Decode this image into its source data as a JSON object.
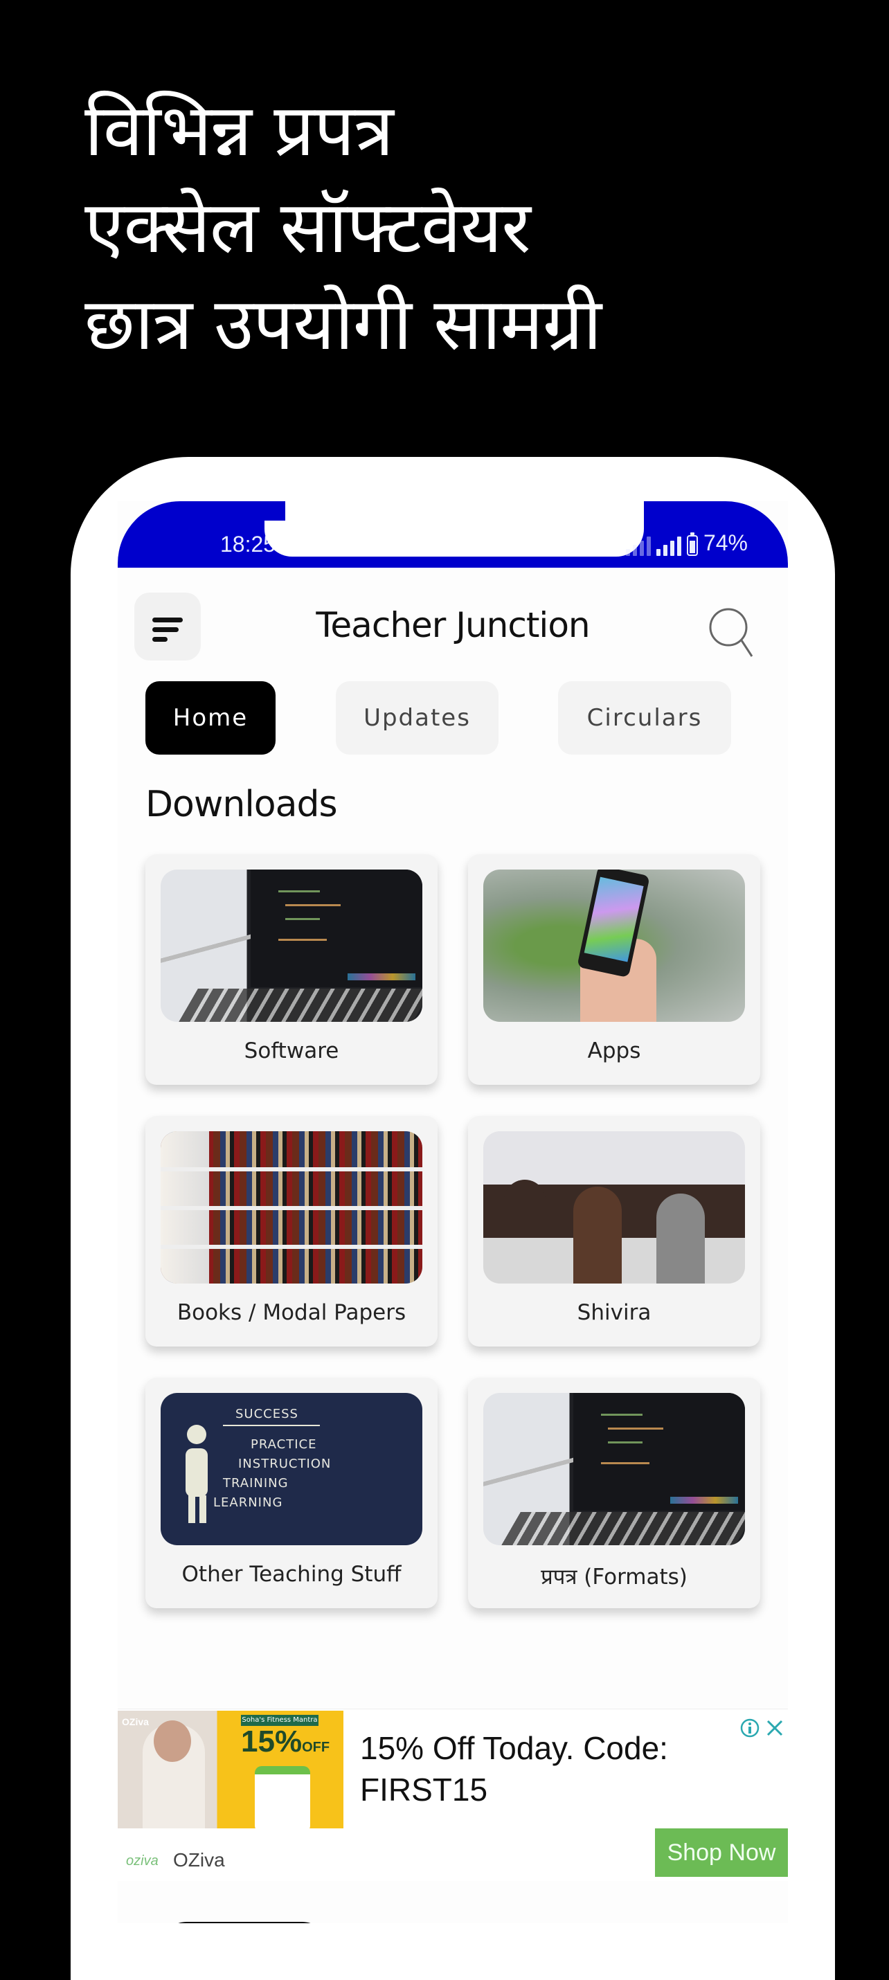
{
  "promo": {
    "lines": [
      "विभिन्न प्रपत्र",
      "एक्सेल सॉफ्टवेयर",
      "छात्र उपयोगी सामग्री"
    ]
  },
  "status_bar": {
    "time": "18:25",
    "battery_percent": "74%",
    "background_color": "#0000cc"
  },
  "header": {
    "title": "Teacher Junction",
    "menu_icon": "menu-icon",
    "search_icon": "search-icon"
  },
  "tabs": [
    {
      "label": "Home",
      "active": true
    },
    {
      "label": "Updates",
      "active": false
    },
    {
      "label": "Circulars",
      "active": false
    }
  ],
  "section": {
    "title": "Downloads"
  },
  "cards": [
    {
      "label": "Software",
      "image": "laptop-code"
    },
    {
      "label": "Apps",
      "image": "smartphone-in-hand"
    },
    {
      "label": "Books / Modal Papers",
      "image": "library-bookshelves"
    },
    {
      "label": "Shivira",
      "image": "classroom-seminar"
    },
    {
      "label": "Other Teaching Stuff",
      "image": "chalkboard-stairs"
    },
    {
      "label": "प्रपत्र (Formats)",
      "image": "laptop-code"
    }
  ],
  "chalkboard_words": [
    "SUCCESS",
    "PRACTICE",
    "INSTRUCTION",
    "TRAINING",
    "LEARNING"
  ],
  "ad": {
    "image_banner": "Soha's Fitness Mantra",
    "image_offer": "15%",
    "image_offer_suffix": "OFF",
    "image_brand": "OZiva",
    "headline": "15% Off Today. Code: FIRST15",
    "brand_logo": "oziva",
    "brand_name": "OZiva",
    "cta": "Shop Now",
    "cta_color": "#6cbb55",
    "icon_color": "#2aa8b0"
  }
}
